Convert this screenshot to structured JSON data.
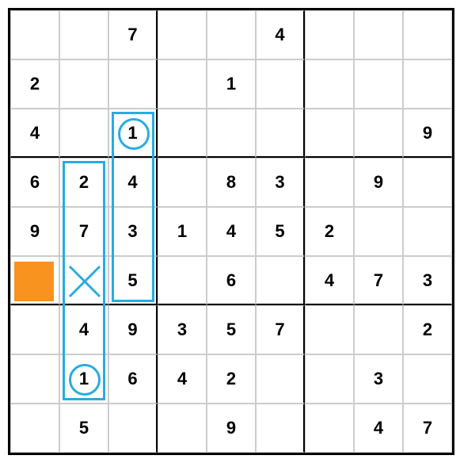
{
  "chart_data": {
    "type": "table",
    "title": "Sudoku puzzle with solving annotations",
    "grid": [
      [
        "",
        "",
        "7",
        "",
        "",
        "4",
        "",
        "",
        ""
      ],
      [
        "2",
        "",
        "",
        "",
        "1",
        "",
        "",
        "",
        ""
      ],
      [
        "4",
        "",
        "1",
        "",
        "",
        "",
        "",
        "",
        "9"
      ],
      [
        "6",
        "2",
        "4",
        "",
        "8",
        "3",
        "",
        "9",
        ""
      ],
      [
        "9",
        "7",
        "3",
        "1",
        "4",
        "5",
        "2",
        "",
        ""
      ],
      [
        "",
        "",
        "5",
        "",
        "6",
        "",
        "4",
        "7",
        "3"
      ],
      [
        "",
        "4",
        "9",
        "3",
        "5",
        "7",
        "",
        "",
        "2"
      ],
      [
        "",
        "1",
        "6",
        "4",
        "2",
        "",
        "",
        "3",
        ""
      ],
      [
        "",
        "5",
        "",
        "",
        "9",
        "",
        "",
        "4",
        "7"
      ]
    ],
    "annotations": {
      "orange_fill_cell": {
        "row": 5,
        "col": 0
      },
      "x_mark_cell": {
        "row": 5,
        "col": 1
      },
      "circled_cells": [
        {
          "row": 2,
          "col": 2
        },
        {
          "row": 7,
          "col": 1
        }
      ],
      "blue_rectangles": [
        {
          "row_start": 3,
          "row_end": 7,
          "col": 1
        },
        {
          "row_start": 2,
          "row_end": 5,
          "col": 2
        }
      ]
    },
    "colors": {
      "highlight": "#f7931e",
      "annotation": "#29abe2"
    }
  },
  "cells": {
    "r0c0": "",
    "r0c1": "",
    "r0c2": "7",
    "r0c3": "",
    "r0c4": "",
    "r0c5": "4",
    "r0c6": "",
    "r0c7": "",
    "r0c8": "",
    "r1c0": "2",
    "r1c1": "",
    "r1c2": "",
    "r1c3": "",
    "r1c4": "1",
    "r1c5": "",
    "r1c6": "",
    "r1c7": "",
    "r1c8": "",
    "r2c0": "4",
    "r2c1": "",
    "r2c2": "1",
    "r2c3": "",
    "r2c4": "",
    "r2c5": "",
    "r2c6": "",
    "r2c7": "",
    "r2c8": "9",
    "r3c0": "6",
    "r3c1": "2",
    "r3c2": "4",
    "r3c3": "",
    "r3c4": "8",
    "r3c5": "3",
    "r3c6": "",
    "r3c7": "9",
    "r3c8": "",
    "r4c0": "9",
    "r4c1": "7",
    "r4c2": "3",
    "r4c3": "1",
    "r4c4": "4",
    "r4c5": "5",
    "r4c6": "2",
    "r4c7": "",
    "r4c8": "",
    "r5c0": "",
    "r5c1": "",
    "r5c2": "5",
    "r5c3": "",
    "r5c4": "6",
    "r5c5": "",
    "r5c6": "4",
    "r5c7": "7",
    "r5c8": "3",
    "r6c0": "",
    "r6c1": "4",
    "r6c2": "9",
    "r6c3": "3",
    "r6c4": "5",
    "r6c5": "7",
    "r6c6": "",
    "r6c7": "",
    "r6c8": "2",
    "r7c0": "",
    "r7c1": "1",
    "r7c2": "6",
    "r7c3": "4",
    "r7c4": "2",
    "r7c5": "",
    "r7c6": "",
    "r7c7": "3",
    "r7c8": "",
    "r8c0": "",
    "r8c1": "5",
    "r8c2": "",
    "r8c3": "",
    "r8c4": "9",
    "r8c5": "",
    "r8c6": "",
    "r8c7": "4",
    "r8c8": "7"
  }
}
